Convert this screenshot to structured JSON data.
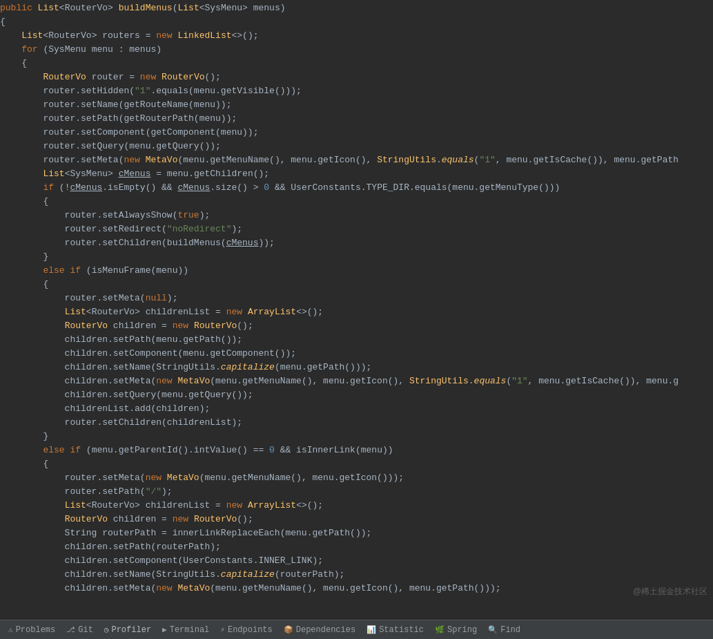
{
  "code": {
    "lines": [
      {
        "num": "",
        "tokens": [
          {
            "t": "public ",
            "c": "kw"
          },
          {
            "t": "List",
            "c": "class-name"
          },
          {
            "t": "<RouterVo> ",
            "c": "op"
          },
          {
            "t": "buildMenus",
            "c": "method"
          },
          {
            "t": "(",
            "c": "op"
          },
          {
            "t": "List",
            "c": "class-name"
          },
          {
            "t": "<SysMenu> menus)",
            "c": "op"
          }
        ]
      },
      {
        "num": "",
        "tokens": [
          {
            "t": "{",
            "c": "op"
          }
        ]
      },
      {
        "num": "",
        "tokens": [
          {
            "t": "    ",
            "c": "op"
          },
          {
            "t": "List",
            "c": "class-name"
          },
          {
            "t": "<RouterVo> routers = ",
            "c": "op"
          },
          {
            "t": "new ",
            "c": "kw"
          },
          {
            "t": "LinkedList",
            "c": "class-name"
          },
          {
            "t": "<>()",
            "c": "op"
          },
          {
            "t": ";",
            "c": "op"
          }
        ]
      },
      {
        "num": "",
        "tokens": [
          {
            "t": "    ",
            "c": "op"
          },
          {
            "t": "for ",
            "c": "kw"
          },
          {
            "t": "(SysMenu menu : menus)",
            "c": "op"
          }
        ]
      },
      {
        "num": "",
        "tokens": [
          {
            "t": "    ",
            "c": "op"
          },
          {
            "t": "{",
            "c": "op"
          }
        ]
      },
      {
        "num": "",
        "tokens": [
          {
            "t": "        ",
            "c": "op"
          },
          {
            "t": "RouterVo",
            "c": "class-name"
          },
          {
            "t": " router = ",
            "c": "op"
          },
          {
            "t": "new ",
            "c": "kw"
          },
          {
            "t": "RouterVo",
            "c": "class-name"
          },
          {
            "t": "();",
            "c": "op"
          }
        ]
      },
      {
        "num": "",
        "tokens": [
          {
            "t": "        router.setHidden(",
            "c": "op"
          },
          {
            "t": "\"1\"",
            "c": "string"
          },
          {
            "t": ".equals(menu.getVisible()));",
            "c": "op"
          }
        ]
      },
      {
        "num": "",
        "tokens": [
          {
            "t": "        router.setName(getRouteName(menu));",
            "c": "op"
          }
        ]
      },
      {
        "num": "",
        "tokens": [
          {
            "t": "        router.setPath(getRouterPath(menu));",
            "c": "op"
          }
        ]
      },
      {
        "num": "",
        "tokens": [
          {
            "t": "        router.setComponent(getComponent(menu));",
            "c": "op"
          }
        ]
      },
      {
        "num": "",
        "tokens": [
          {
            "t": "        router.setQuery(menu.getQuery());",
            "c": "op"
          }
        ]
      },
      {
        "num": "",
        "tokens": [
          {
            "t": "        router.setMeta(",
            "c": "op"
          },
          {
            "t": "new ",
            "c": "kw"
          },
          {
            "t": "MetaVo",
            "c": "class-name"
          },
          {
            "t": "(menu.getMenuName(), menu.getIcon(), ",
            "c": "op"
          },
          {
            "t": "StringUtils",
            "c": "class-name"
          },
          {
            "t": ".",
            "c": "op"
          },
          {
            "t": "equals",
            "c": "static-method"
          },
          {
            "t": "(",
            "c": "op"
          },
          {
            "t": "\"1\"",
            "c": "string"
          },
          {
            "t": ", menu.getIsCache()), menu.getPath",
            "c": "op"
          }
        ]
      },
      {
        "num": "",
        "tokens": [
          {
            "t": "        ",
            "c": "op"
          },
          {
            "t": "List",
            "c": "class-name"
          },
          {
            "t": "<SysMenu> ",
            "c": "op"
          },
          {
            "t": "cMenus",
            "c": "var underline"
          },
          {
            "t": " = menu.getChildren();",
            "c": "op"
          }
        ]
      },
      {
        "num": "",
        "tokens": [
          {
            "t": "        ",
            "c": "op"
          },
          {
            "t": "if ",
            "c": "kw"
          },
          {
            "t": "(!",
            "c": "op"
          },
          {
            "t": "cMenus",
            "c": "var underline"
          },
          {
            "t": ".isEmpty() && ",
            "c": "op"
          },
          {
            "t": "cMenus",
            "c": "var underline"
          },
          {
            "t": ".size() > ",
            "c": "op"
          },
          {
            "t": "0",
            "c": "number"
          },
          {
            "t": " && UserConstants.TYPE_DIR.equals(menu.getMenuType()))",
            "c": "op"
          }
        ]
      },
      {
        "num": "",
        "tokens": [
          {
            "t": "        {",
            "c": "op"
          }
        ]
      },
      {
        "num": "",
        "tokens": [
          {
            "t": "            router.setAlwaysShow(",
            "c": "op"
          },
          {
            "t": "true",
            "c": "bool"
          },
          {
            "t": ");",
            "c": "op"
          }
        ]
      },
      {
        "num": "",
        "tokens": [
          {
            "t": "            router.setRedirect(",
            "c": "op"
          },
          {
            "t": "\"noRedirect\"",
            "c": "string"
          },
          {
            "t": ");",
            "c": "op"
          }
        ]
      },
      {
        "num": "",
        "tokens": [
          {
            "t": "            router.setChildren(buildMenus(",
            "c": "op"
          },
          {
            "t": "cMenus",
            "c": "var underline"
          },
          {
            "t": "));",
            "c": "op"
          }
        ]
      },
      {
        "num": "",
        "tokens": [
          {
            "t": "        }",
            "c": "op"
          }
        ]
      },
      {
        "num": "",
        "tokens": [
          {
            "t": "        ",
            "c": "op"
          },
          {
            "t": "else if ",
            "c": "kw"
          },
          {
            "t": "(isMenuFrame(menu))",
            "c": "op"
          }
        ]
      },
      {
        "num": "",
        "tokens": [
          {
            "t": "        {",
            "c": "op"
          }
        ]
      },
      {
        "num": "",
        "tokens": [
          {
            "t": "            router.setMeta(",
            "c": "op"
          },
          {
            "t": "null",
            "c": "null-kw"
          },
          {
            "t": ");",
            "c": "op"
          }
        ]
      },
      {
        "num": "",
        "tokens": [
          {
            "t": "            ",
            "c": "op"
          },
          {
            "t": "List",
            "c": "class-name"
          },
          {
            "t": "<RouterVo> childrenList = ",
            "c": "op"
          },
          {
            "t": "new ",
            "c": "kw"
          },
          {
            "t": "ArrayList",
            "c": "class-name"
          },
          {
            "t": "<>()",
            "c": "op"
          },
          {
            "t": ";",
            "c": "op"
          }
        ]
      },
      {
        "num": "",
        "tokens": [
          {
            "t": "            ",
            "c": "op"
          },
          {
            "t": "RouterVo",
            "c": "class-name"
          },
          {
            "t": " children = ",
            "c": "op"
          },
          {
            "t": "new ",
            "c": "kw"
          },
          {
            "t": "RouterVo",
            "c": "class-name"
          },
          {
            "t": "();",
            "c": "op"
          }
        ]
      },
      {
        "num": "",
        "tokens": [
          {
            "t": "            children.setPath(menu.getPath());",
            "c": "op"
          }
        ]
      },
      {
        "num": "",
        "tokens": [
          {
            "t": "            children.setComponent(menu.getComponent());",
            "c": "op"
          }
        ]
      },
      {
        "num": "",
        "tokens": [
          {
            "t": "            children.setName(StringUtils.",
            "c": "op"
          },
          {
            "t": "capitalize",
            "c": "static-method italic"
          },
          {
            "t": "(menu.getPath()));",
            "c": "op"
          }
        ]
      },
      {
        "num": "",
        "tokens": [
          {
            "t": "            children.setMeta(",
            "c": "op"
          },
          {
            "t": "new ",
            "c": "kw"
          },
          {
            "t": "MetaVo",
            "c": "class-name"
          },
          {
            "t": "(menu.getMenuName(), menu.getIcon(), ",
            "c": "op"
          },
          {
            "t": "StringUtils",
            "c": "class-name"
          },
          {
            "t": ".",
            "c": "op"
          },
          {
            "t": "equals",
            "c": "static-method"
          },
          {
            "t": "(",
            "c": "op"
          },
          {
            "t": "\"1\"",
            "c": "string"
          },
          {
            "t": ", menu.getIsCache()), menu.g",
            "c": "op"
          }
        ]
      },
      {
        "num": "",
        "tokens": [
          {
            "t": "            children.setQuery(menu.getQuery());",
            "c": "op"
          }
        ]
      },
      {
        "num": "",
        "tokens": [
          {
            "t": "            childrenList.add(children);",
            "c": "op"
          }
        ]
      },
      {
        "num": "",
        "tokens": [
          {
            "t": "            router.setChildren(childrenList);",
            "c": "op"
          }
        ]
      },
      {
        "num": "",
        "tokens": [
          {
            "t": "        }",
            "c": "op"
          }
        ]
      },
      {
        "num": "",
        "tokens": [
          {
            "t": "        ",
            "c": "op"
          },
          {
            "t": "else if ",
            "c": "kw"
          },
          {
            "t": "(menu.getParentId().intValue() == ",
            "c": "op"
          },
          {
            "t": "0",
            "c": "number"
          },
          {
            "t": " && isInnerLink(menu))",
            "c": "op"
          }
        ]
      },
      {
        "num": "",
        "tokens": [
          {
            "t": "        {",
            "c": "op"
          }
        ]
      },
      {
        "num": "",
        "tokens": [
          {
            "t": "            router.setMeta(",
            "c": "op"
          },
          {
            "t": "new ",
            "c": "kw"
          },
          {
            "t": "MetaVo",
            "c": "class-name"
          },
          {
            "t": "(menu.getMenuName(), menu.getIcon()));",
            "c": "op"
          }
        ]
      },
      {
        "num": "",
        "tokens": [
          {
            "t": "            router.setPath(",
            "c": "op"
          },
          {
            "t": "\"/\"",
            "c": "string"
          },
          {
            "t": ");",
            "c": "op"
          }
        ]
      },
      {
        "num": "",
        "tokens": [
          {
            "t": "            ",
            "c": "op"
          },
          {
            "t": "List",
            "c": "class-name"
          },
          {
            "t": "<RouterVo> childrenList = ",
            "c": "op"
          },
          {
            "t": "new ",
            "c": "kw"
          },
          {
            "t": "ArrayList",
            "c": "class-name"
          },
          {
            "t": "<>()",
            "c": "op"
          },
          {
            "t": ";",
            "c": "op"
          }
        ]
      },
      {
        "num": "",
        "tokens": [
          {
            "t": "            ",
            "c": "op"
          },
          {
            "t": "RouterVo",
            "c": "class-name"
          },
          {
            "t": " children = ",
            "c": "op"
          },
          {
            "t": "new ",
            "c": "kw"
          },
          {
            "t": "RouterVo",
            "c": "class-name"
          },
          {
            "t": "();",
            "c": "op"
          }
        ]
      },
      {
        "num": "",
        "tokens": [
          {
            "t": "            String routerPath = innerLinkReplaceEach(menu.getPath());",
            "c": "op"
          }
        ]
      },
      {
        "num": "",
        "tokens": [
          {
            "t": "            children.setPath(routerPath);",
            "c": "op"
          }
        ]
      },
      {
        "num": "",
        "tokens": [
          {
            "t": "            children.setComponent(UserConstants.INNER_LINK);",
            "c": "op"
          }
        ]
      },
      {
        "num": "",
        "tokens": [
          {
            "t": "            children.setName(StringUtils.",
            "c": "op"
          },
          {
            "t": "capitalize",
            "c": "static-method italic"
          },
          {
            "t": "(routerPath);",
            "c": "op"
          }
        ]
      },
      {
        "num": "",
        "tokens": [
          {
            "t": "            children.setMeta(",
            "c": "op"
          },
          {
            "t": "new ",
            "c": "kw"
          },
          {
            "t": "MetaVo",
            "c": "class-name"
          },
          {
            "t": "(menu.getMenuName(), menu.getIcon(), menu.getPath()));",
            "c": "op"
          }
        ]
      }
    ]
  },
  "bottombar": {
    "tabs": [
      {
        "label": "Problems",
        "icon": "⚠",
        "active": false
      },
      {
        "label": "Git",
        "icon": "⎇",
        "active": false
      },
      {
        "label": "Profiler",
        "icon": "◷",
        "active": true
      },
      {
        "label": "Terminal",
        "icon": "▶",
        "active": false
      },
      {
        "label": "Endpoints",
        "icon": "⚡",
        "active": false
      },
      {
        "label": "Dependencies",
        "icon": "📦",
        "active": false
      },
      {
        "label": "Statistic",
        "icon": "📊",
        "active": false
      },
      {
        "label": "Spring",
        "icon": "🌿",
        "active": false
      },
      {
        "label": "Find",
        "icon": "🔍",
        "active": false
      }
    ]
  },
  "watermark": "@稀土掘金技术社区"
}
